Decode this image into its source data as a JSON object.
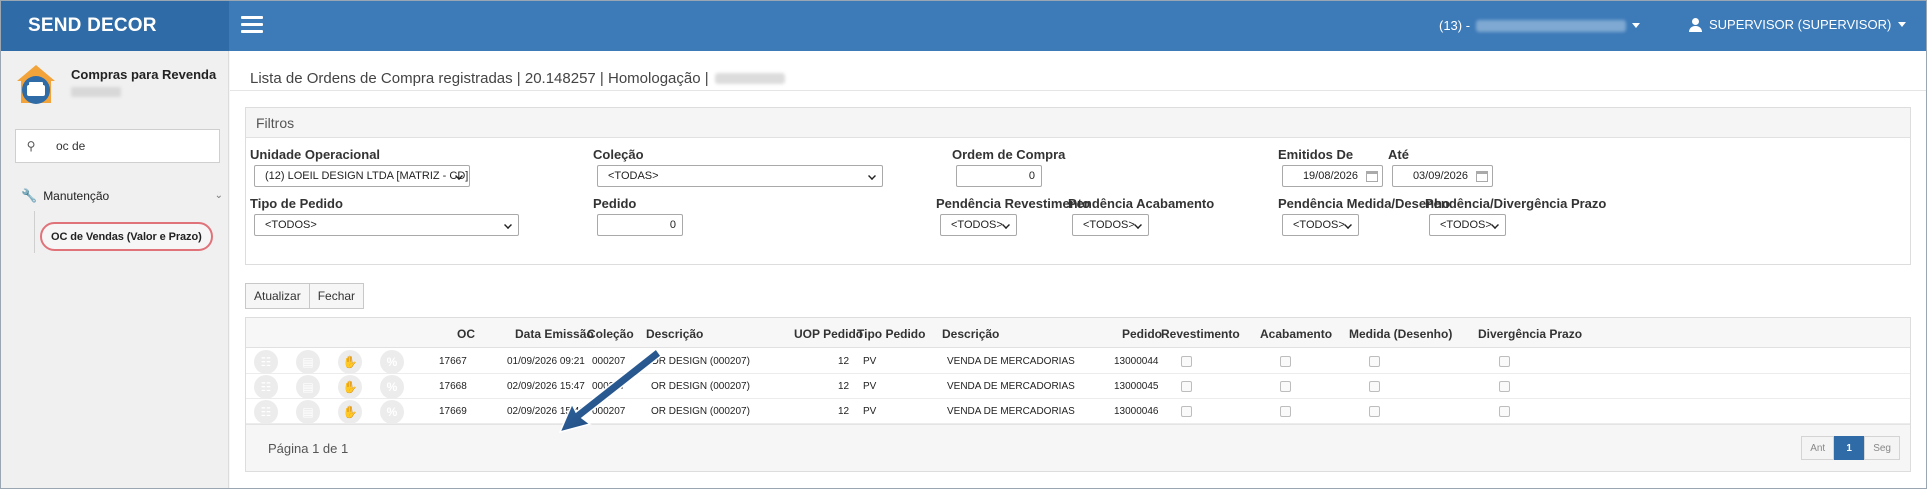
{
  "app": {
    "brand": "SEND DECOR",
    "company_prefix": "(13) -",
    "user": "SUPERVISOR (SUPERVISOR)"
  },
  "sidebar": {
    "module_title": "Compras para Revenda",
    "search_value": "oc de",
    "group_label": "Manutenção",
    "active_item": "OC de Vendas (Valor e Prazo)"
  },
  "page": {
    "title": "Lista de Ordens de Compra registradas | 20.148257 | Homologação |"
  },
  "filters": {
    "header": "Filtros",
    "unidade": {
      "label": "Unidade Operacional",
      "value": "(12) LOEIL DESIGN LTDA [MATRIZ - CD]"
    },
    "colecao": {
      "label": "Coleção",
      "value": "<TODAS>"
    },
    "ordem": {
      "label": "Ordem de Compra",
      "value": "0"
    },
    "emitidos_de": {
      "label": "Emitidos De",
      "value": "19/08/2026"
    },
    "ate": {
      "label": "Até",
      "value": "03/09/2026"
    },
    "tipo_pedido": {
      "label": "Tipo de Pedido",
      "value": "<TODOS>"
    },
    "pedido": {
      "label": "Pedido",
      "value": "0"
    },
    "pend_revest": {
      "label": "Pendência Revestimento",
      "value": "<TODOS>"
    },
    "pend_acab": {
      "label": "Pendência Acabamento",
      "value": "<TODOS>"
    },
    "pend_medida": {
      "label": "Pendência Medida/Desenho",
      "value": "<TODOS>"
    },
    "pend_prazo": {
      "label": "Pendência/Divergência Prazo",
      "value": "<TODOS>"
    }
  },
  "actions": {
    "refresh": "Atualizar",
    "close": "Fechar"
  },
  "table": {
    "columns": {
      "oc": "OC",
      "data": "Data Emissão",
      "colecao": "Coleção",
      "descricao": "Descrição",
      "uop": "UOP Pedido",
      "tipo": "Tipo Pedido",
      "descricao2": "Descrição",
      "pedido": "Pedido",
      "revest": "Revestimento",
      "acab": "Acabamento",
      "medida": "Medida (Desenho)",
      "diverg": "Divergência Prazo"
    },
    "row_icons": [
      "calendar-icon",
      "money-icon",
      "hand-icon",
      "percent-icon"
    ],
    "rows": [
      {
        "oc": "17667",
        "data": "01/09/2026 09:21",
        "colecao": "000207",
        "descricao": "OR DESIGN (000207)",
        "uop": "12",
        "tipo": "PV",
        "descricao2": "VENDA DE MERCADORIAS",
        "pedido": "13000044"
      },
      {
        "oc": "17668",
        "data": "02/09/2026 15:47",
        "colecao": "000207",
        "descricao": "OR DESIGN (000207)",
        "uop": "12",
        "tipo": "PV",
        "descricao2": "VENDA DE MERCADORIAS",
        "pedido": "13000045"
      },
      {
        "oc": "17669",
        "data": "02/09/2026 15:48",
        "colecao": "000207",
        "descricao": "OR DESIGN (000207)",
        "uop": "12",
        "tipo": "PV",
        "descricao2": "VENDA DE MERCADORIAS",
        "pedido": "13000046"
      }
    ],
    "page_info": "Página 1 de 1",
    "pager": {
      "prev": "Ant",
      "current": "1",
      "next": "Seg"
    }
  },
  "colors": {
    "topbar": "#3c7ab8",
    "brand_bg": "#2f6ba6",
    "highlight": "#e0737a",
    "arrow": "#1f4f86"
  }
}
